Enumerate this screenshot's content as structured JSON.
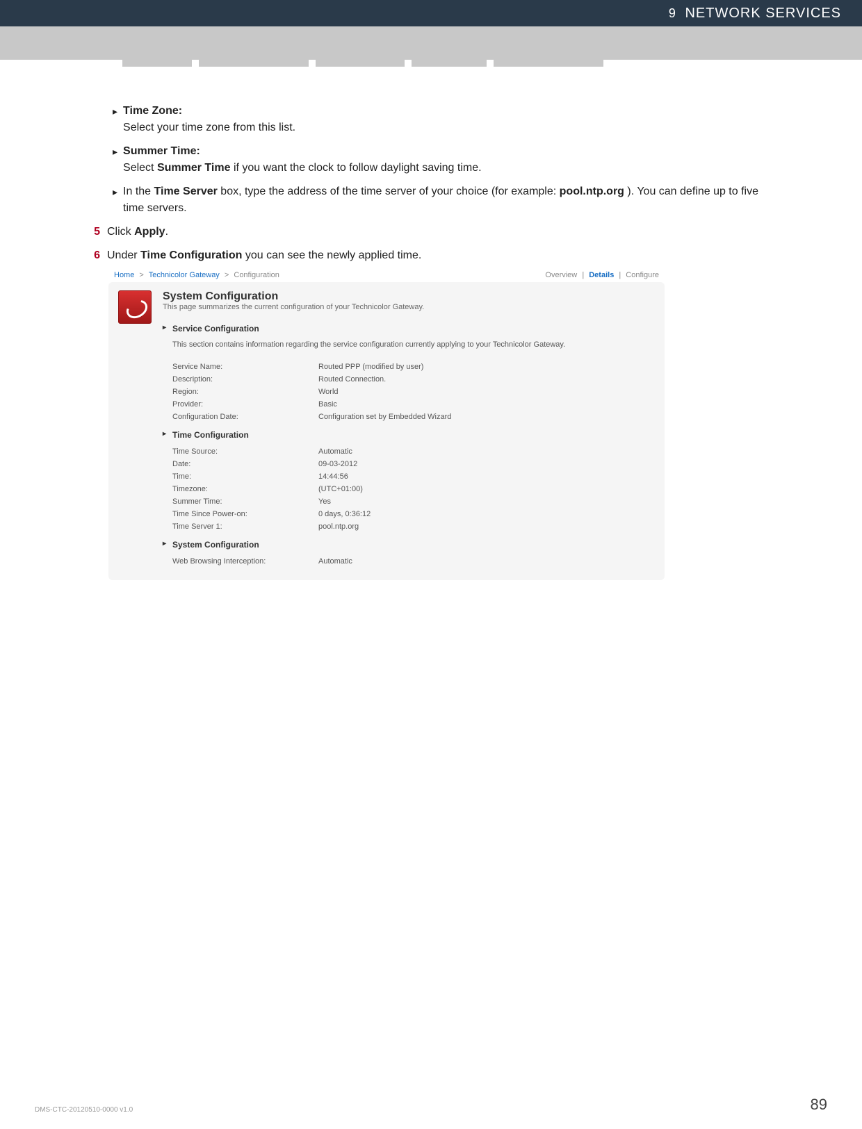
{
  "header": {
    "chapter_num": "9",
    "chapter_title": "NETWORK SERVICES"
  },
  "instructions": {
    "bullet1_title": "Time Zone:",
    "bullet1_desc": "Select your time zone from this list.",
    "bullet2_title": "Summer Time:",
    "bullet2_desc_pre": "Select ",
    "bullet2_desc_bold": "Summer Time",
    "bullet2_desc_post": " if you want the clock to follow daylight saving time.",
    "bullet3_pre": "In the ",
    "bullet3_b1": "Time Server",
    "bullet3_mid": " box, type the address of the time server of your choice (for example: ",
    "bullet3_b2": "pool.ntp.org",
    "bullet3_post": "). You can define up to five time servers.",
    "step5_num": "5",
    "step5_pre": "Click ",
    "step5_b": "Apply",
    "step5_post": ".",
    "step6_num": "6",
    "step6_pre": "Under ",
    "step6_b": "Time Configuration",
    "step6_post": " you can see the newly applied time."
  },
  "screenshot": {
    "crumbs": {
      "home": "Home",
      "gw": "Technicolor Gateway",
      "cfg": "Configuration"
    },
    "tabs": {
      "overview": "Overview",
      "details": "Details",
      "configure": "Configure"
    },
    "title": "System Configuration",
    "subtitle": "This page summarizes the current configuration of your Technicolor Gateway.",
    "svc": {
      "header": "Service Configuration",
      "desc": "This section contains information regarding the service configuration currently applying to your Technicolor Gateway.",
      "rows": [
        {
          "k": "Service Name:",
          "v": "Routed PPP (modified by user)"
        },
        {
          "k": "Description:",
          "v": "Routed Connection."
        },
        {
          "k": "Region:",
          "v": "World"
        },
        {
          "k": "Provider:",
          "v": "Basic"
        },
        {
          "k": "Configuration Date:",
          "v": "Configuration set by Embedded Wizard"
        }
      ]
    },
    "time": {
      "header": "Time Configuration",
      "rows": [
        {
          "k": "Time Source:",
          "v": "Automatic"
        },
        {
          "k": "Date:",
          "v": "09-03-2012"
        },
        {
          "k": "Time:",
          "v": "14:44:56"
        },
        {
          "k": "Timezone:",
          "v": "(UTC+01:00)"
        },
        {
          "k": "Summer Time:",
          "v": "Yes"
        },
        {
          "k": "Time Since Power-on:",
          "v": "0 days, 0:36:12"
        },
        {
          "k": "Time Server 1:",
          "v": "pool.ntp.org"
        }
      ]
    },
    "sys": {
      "header": "System Configuration",
      "rows": [
        {
          "k": "Web Browsing Interception:",
          "v": "Automatic"
        }
      ]
    }
  },
  "footer": {
    "doc_id": "DMS-CTC-20120510-0000 v1.0",
    "page": "89"
  }
}
